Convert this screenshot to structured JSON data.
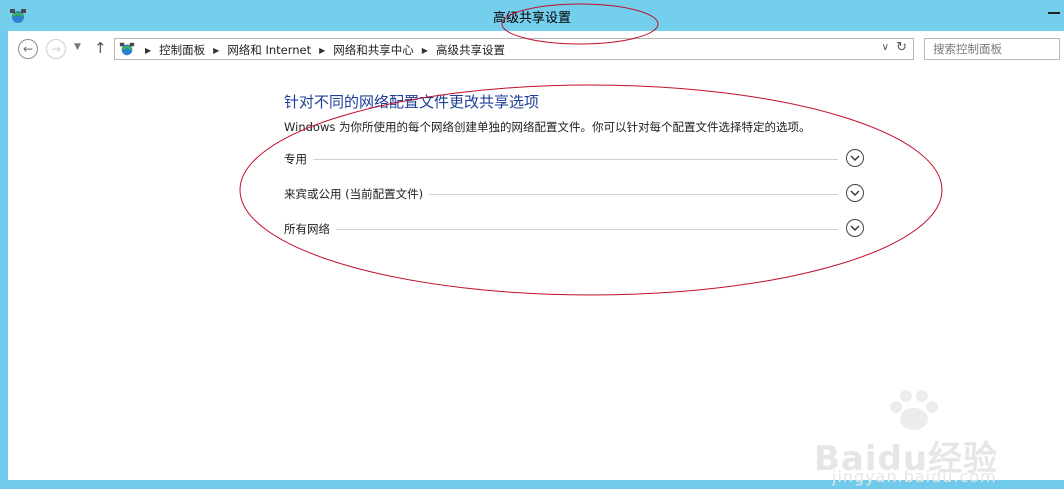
{
  "window": {
    "title": "高级共享设置"
  },
  "address_bar": {
    "breadcrumbs": [
      {
        "label": "控制面板"
      },
      {
        "label": "网络和 Internet"
      },
      {
        "label": "网络和共享中心"
      },
      {
        "label": "高级共享设置"
      }
    ]
  },
  "search": {
    "placeholder": "搜索控制面板"
  },
  "main": {
    "heading": "针对不同的网络配置文件更改共享选项",
    "description": "Windows 为你所使用的每个网络创建单独的网络配置文件。你可以针对每个配置文件选择特定的选项。",
    "sections": [
      {
        "label": "专用"
      },
      {
        "label": "来宾或公用 (当前配置文件)"
      },
      {
        "label": "所有网络"
      }
    ]
  },
  "watermark": {
    "brand": "Baidu经验",
    "url": "jingyan.baidu.com"
  },
  "colors": {
    "titlebar": "#74cfec",
    "heading": "#1e3f99",
    "annotation": "#c0102a"
  },
  "icons": [
    "network-icon",
    "back-icon",
    "forward-icon",
    "chevron-down-icon",
    "up-arrow-icon",
    "refresh-icon",
    "expand-icon",
    "minimize-icon"
  ]
}
